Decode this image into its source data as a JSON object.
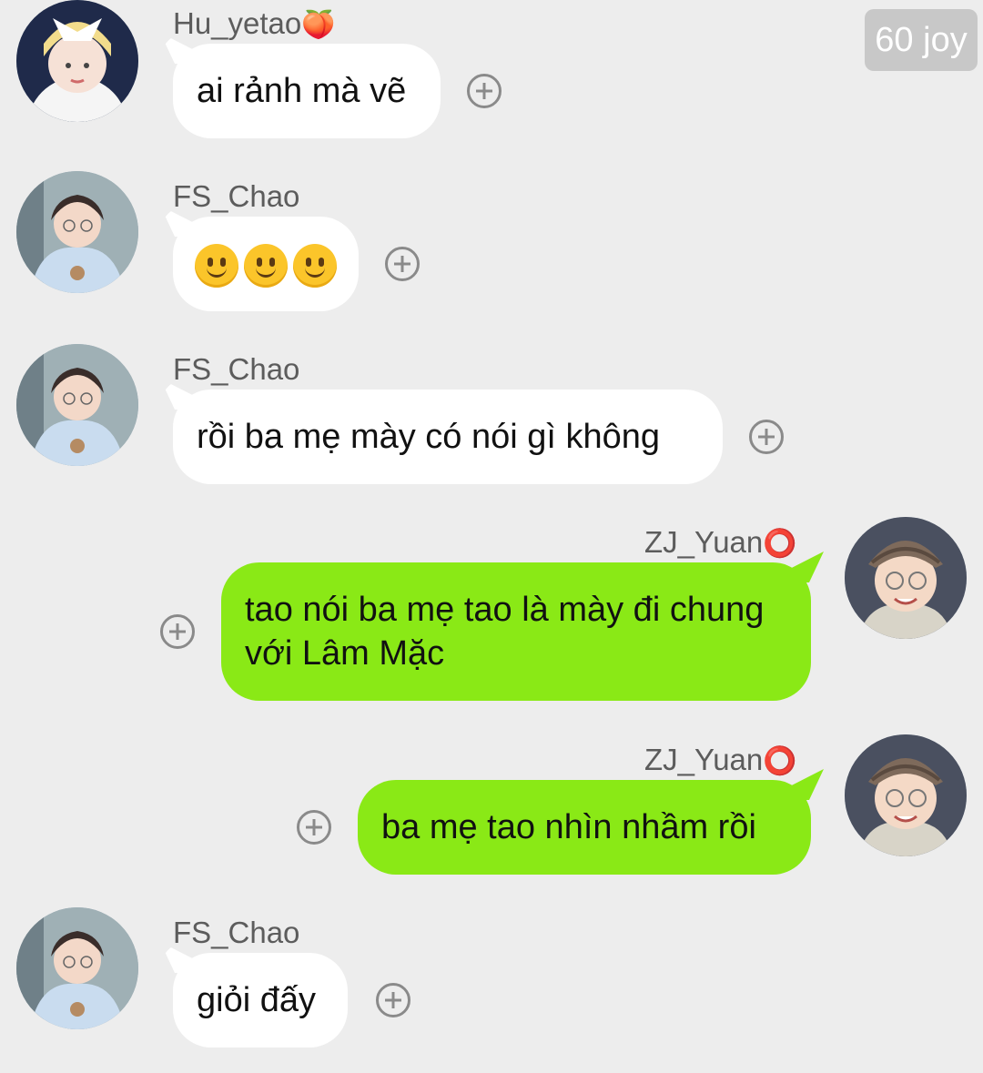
{
  "badge": "60 joy",
  "colors": {
    "background": "#ededed",
    "incoming_bubble": "#ffffff",
    "outgoing_bubble": "#8ae916",
    "badge": "#c8c8c8"
  },
  "messages": [
    {
      "sender": "Hu_yetao",
      "sender_suffix_icon": "peach-icon",
      "direction": "incoming",
      "text": "ai rảnh mà vẽ"
    },
    {
      "sender": "FS_Chao",
      "direction": "incoming",
      "emoji": [
        "🙂",
        "🙂",
        "🙂"
      ],
      "emoji_icon": "slightly-smiling-face-icon"
    },
    {
      "sender": "FS_Chao",
      "direction": "incoming",
      "text": "rồi ba mẹ mày có nói gì không"
    },
    {
      "sender": "ZJ_Yuan",
      "sender_suffix_icon": "red-circle-icon",
      "direction": "outgoing",
      "text": "tao nói ba mẹ tao là mày đi chung với Lâm Mặc"
    },
    {
      "sender": "ZJ_Yuan",
      "sender_suffix_icon": "red-circle-icon",
      "direction": "outgoing",
      "text": "ba mẹ tao nhìn nhầm rồi"
    },
    {
      "sender": "FS_Chao",
      "direction": "incoming",
      "text": "giỏi đấy"
    }
  ]
}
